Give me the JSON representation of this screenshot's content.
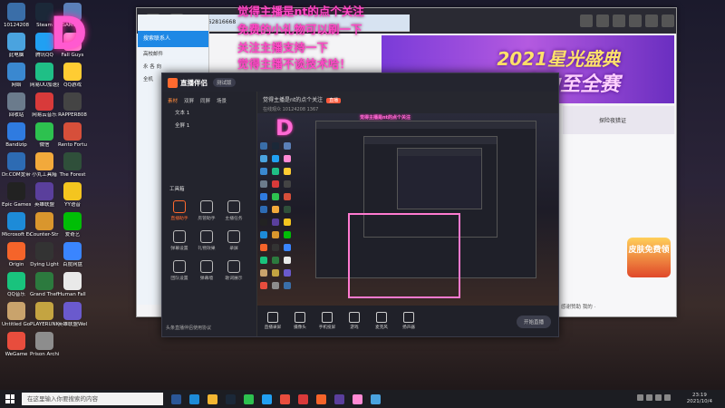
{
  "overlay": {
    "comments": [
      "觉得主播是nt的点个关注",
      "免费的小礼物可以刷一下",
      "关注主播支持一下",
      "觉得主播不谈技术哈！"
    ],
    "logo_letter": "D"
  },
  "desktop": {
    "icons": [
      {
        "label": "10124208",
        "color": "#3a6ea8"
      },
      {
        "label": "此电脑",
        "color": "#4aa3df"
      },
      {
        "label": "网络",
        "color": "#3a88d0"
      },
      {
        "label": "回收站",
        "color": "#6b7b8c"
      },
      {
        "label": "Bandizip",
        "color": "#2f7be0"
      },
      {
        "label": "Dr.COM宽带认证客户端",
        "color": "#2d6bb3"
      },
      {
        "label": "Epic Games Launcher",
        "color": "#222222"
      },
      {
        "label": "Microsoft Edge",
        "color": "#1d8bd8"
      },
      {
        "label": "Origin",
        "color": "#f5642a"
      },
      {
        "label": "QQ音乐",
        "color": "#19c37d"
      },
      {
        "label": "Untitled Goose Game",
        "color": "#c9a36c"
      },
      {
        "label": "WeGame",
        "color": "#e84d3d"
      },
      {
        "label": "Steam",
        "color": "#1b2838"
      },
      {
        "label": "腾讯QQ",
        "color": "#21a0f2"
      },
      {
        "label": "网易UU加速器",
        "color": "#1fbf86"
      },
      {
        "label": "网易云音乐",
        "color": "#d83a3a"
      },
      {
        "label": "微信",
        "color": "#2dc14f"
      },
      {
        "label": "小丸工具箱",
        "color": "#f2a93b"
      },
      {
        "label": "英雄联盟",
        "color": "#5a3f9c"
      },
      {
        "label": "Counter-Strike Global Offensive",
        "color": "#d9962d"
      },
      {
        "label": "Dying Light",
        "color": "#333333"
      },
      {
        "label": "Grand Theft Auto V",
        "color": "#2c7a3e"
      },
      {
        "label": "PLAYERUNKNOWN'S BATTLEGROUNDS",
        "color": "#c4a441"
      },
      {
        "label": "Prison Architect",
        "color": "#8d8d8d"
      },
      {
        "label": "SAM工具",
        "color": "#5b80b8"
      },
      {
        "label": "Fall Guys",
        "color": "#ff8ad4"
      },
      {
        "label": "QQ游戏",
        "color": "#ffcc33"
      },
      {
        "label": "RAPPER808",
        "color": "#444444"
      },
      {
        "label": "Rento Fortune",
        "color": "#d64f3a"
      },
      {
        "label": "The Forest",
        "color": "#2f4f3a"
      },
      {
        "label": "YY语音",
        "color": "#f4c51f"
      },
      {
        "label": "爱奇艺",
        "color": "#00be06"
      },
      {
        "label": "百度网盘",
        "color": "#3a85ff"
      },
      {
        "label": "Human Fall Flat",
        "color": "#e9e9e9"
      },
      {
        "label": "英雄联盟WeGame版",
        "color": "#6a5acd"
      }
    ]
  },
  "qq_window": {
    "user": "wanmd",
    "id": "1462816668",
    "search_placeholder": "搜索联系人",
    "rows": [
      "高校邮件",
      "永 各 向",
      "全机"
    ]
  },
  "browser": {
    "banner_line1": "2021星光盛典",
    "banner_line2": "实力至全赛",
    "promo_text": "皮肤免费领",
    "side_link": "探险夜猎证",
    "bottom_links": "感谢赞助   我的 ·"
  },
  "app": {
    "logo": "直播伴侣",
    "version": "测试版",
    "left_tabs": [
      "素材",
      "双屏",
      "同屏",
      "场景"
    ],
    "sources": [
      "文本 1",
      "全屏 1"
    ],
    "tools_title": "工具箱",
    "tools": [
      {
        "label": "直播助手",
        "hot": true
      },
      {
        "label": "房管助手",
        "hot": false
      },
      {
        "label": "主播任务",
        "hot": false
      },
      {
        "label": "弹幕设置",
        "hot": false
      },
      {
        "label": "礼物效果",
        "hot": false
      },
      {
        "label": "录屏",
        "hot": false
      },
      {
        "label": "团队设置",
        "hot": false
      },
      {
        "label": "弹幕墙",
        "hot": false
      },
      {
        "label": "歌词展示",
        "hot": false
      }
    ],
    "footer": "头条直播伴侣使用协议",
    "room_title": "觉得主播是nt的点个关注",
    "room_badge": "直播",
    "room_meta": "在线观众 10124208   1367",
    "bottom_buttons": [
      "直播录屏",
      "摄像头",
      "手机投屏",
      "游戏",
      "麦克风",
      "扬声器"
    ],
    "go_live": "开始直播"
  },
  "taskbar": {
    "search_placeholder": "在这里输入你要搜索的内容",
    "time": "23:19",
    "date": "2021/10/4",
    "icons": [
      "#2b5797",
      "#1d8bd8",
      "#f2b632",
      "#1b2838",
      "#2dc14f",
      "#21a0f2",
      "#e84d3d",
      "#d83a3a",
      "#f5642a",
      "#5a3f9c",
      "#ff8ad4",
      "#4aa3df"
    ]
  }
}
